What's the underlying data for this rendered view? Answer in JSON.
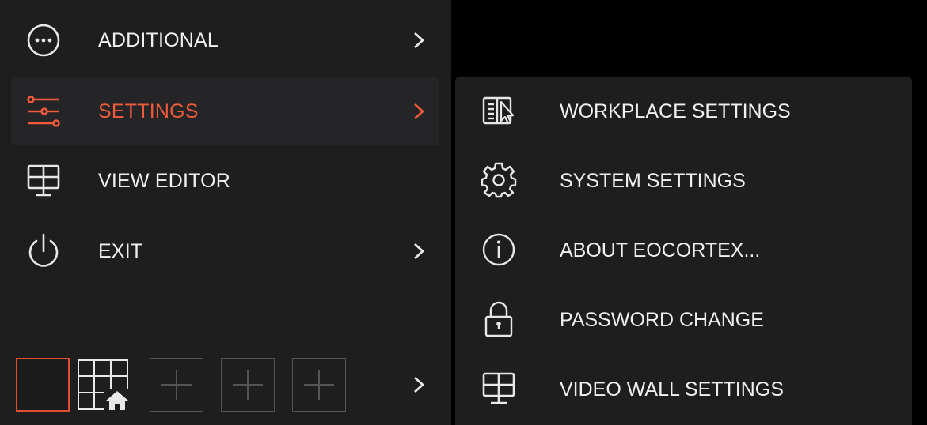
{
  "main_menu": {
    "items": [
      {
        "label": "ADDITIONAL",
        "icon": "more-circle-icon",
        "has_submenu": true,
        "active": false
      },
      {
        "label": "SETTINGS",
        "icon": "sliders-icon",
        "has_submenu": true,
        "active": true
      },
      {
        "label": "VIEW EDITOR",
        "icon": "monitor-grid-icon",
        "has_submenu": false,
        "active": false
      },
      {
        "label": "EXIT",
        "icon": "power-icon",
        "has_submenu": true,
        "active": false
      }
    ]
  },
  "settings_submenu": {
    "items": [
      {
        "label": "WORKPLACE SETTINGS",
        "icon": "workplace-icon"
      },
      {
        "label": "SYSTEM SETTINGS",
        "icon": "gear-icon"
      },
      {
        "label": "ABOUT EOCORTEX...",
        "icon": "info-icon"
      },
      {
        "label": "PASSWORD CHANGE",
        "icon": "lock-icon"
      },
      {
        "label": "VIDEO WALL SETTINGS",
        "icon": "video-wall-icon"
      }
    ]
  },
  "layouts": {
    "slots": [
      "active-layout",
      "home-grid-layout",
      "add",
      "add",
      "add"
    ]
  },
  "colors": {
    "accent": "#ee5a3a",
    "panel_bg": "#1e1e1e",
    "active_bg": "#252528",
    "text": "#f0f0f0",
    "icon": "#e8e8e8",
    "muted": "#555555"
  }
}
